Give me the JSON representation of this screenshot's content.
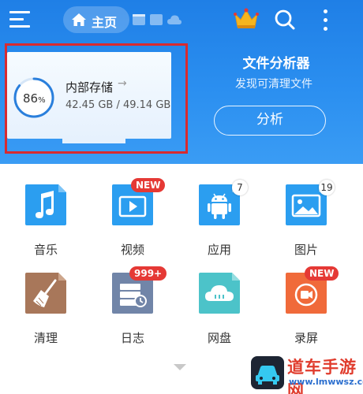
{
  "header": {
    "home_tab_label": "主页",
    "icons": [
      "menu-icon",
      "home-icon",
      "window-icon",
      "card-icon",
      "cloud-icon",
      "crown-icon",
      "search-icon",
      "more-vertical-icon"
    ]
  },
  "storage": {
    "percent": 86,
    "percent_text": "86",
    "percent_unit": "%",
    "title": "内部存储",
    "size_text": "42.45 GB / 49.14 GB"
  },
  "analyzer": {
    "title": "文件分析器",
    "subtitle": "发现可清理文件",
    "button_label": "分析"
  },
  "grid": [
    {
      "label": "音乐",
      "icon": "music-icon",
      "badge": ""
    },
    {
      "label": "视频",
      "icon": "video-icon",
      "badge": "NEW"
    },
    {
      "label": "应用",
      "icon": "android-icon",
      "badge": "7"
    },
    {
      "label": "图片",
      "icon": "image-icon",
      "badge": "19"
    },
    {
      "label": "清理",
      "icon": "broom-icon",
      "badge": ""
    },
    {
      "label": "日志",
      "icon": "log-icon",
      "badge": "999+"
    },
    {
      "label": "网盘",
      "icon": "cloud-drive-icon",
      "badge": ""
    },
    {
      "label": "录屏",
      "icon": "screen-record-icon",
      "badge": "NEW"
    }
  ],
  "watermark": {
    "title": "道车手游网",
    "url": "www.lmwwsz.com"
  },
  "colors": {
    "header_blue": "#2b8ff0",
    "accent_red": "#e53935",
    "ring_blue": "#2a7fdc"
  }
}
